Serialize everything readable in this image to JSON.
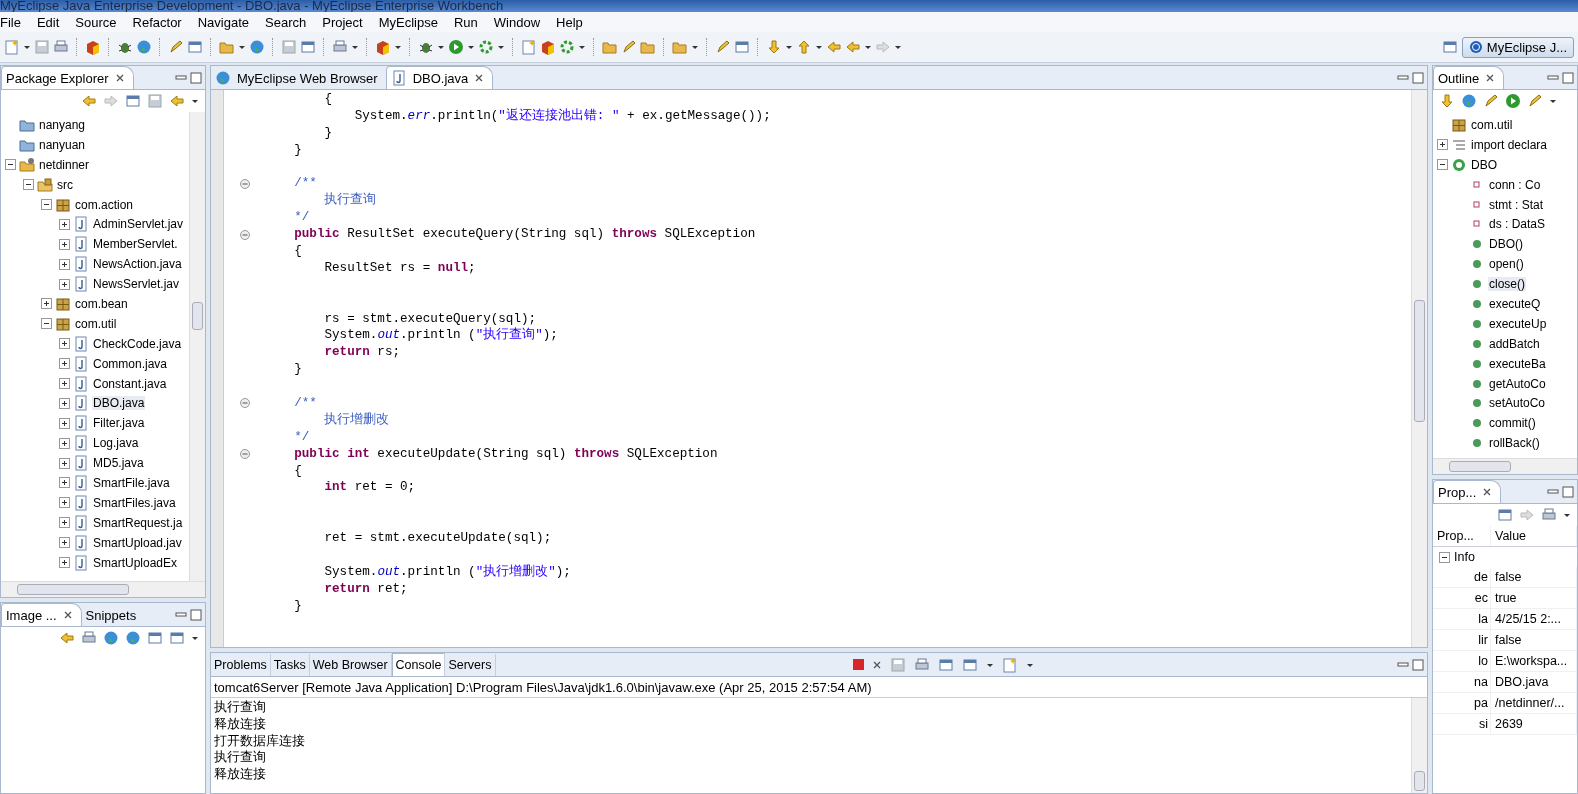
{
  "window": {
    "title": "MyEclipse Java Enterprise Development - DBO.java - MyEclipse Enterprise Workbench"
  },
  "menu": [
    "File",
    "Edit",
    "Source",
    "Refactor",
    "Navigate",
    "Search",
    "Project",
    "MyEclipse",
    "Run",
    "Window",
    "Help"
  ],
  "perspective": {
    "label": "MyEclipse J..."
  },
  "explorer": {
    "tabs": [
      {
        "label": "Package Explorer",
        "selected": true
      }
    ],
    "tree": [
      {
        "kind": "folder",
        "label": "nanyang",
        "selected": false
      },
      {
        "kind": "folder",
        "label": "nanyuan",
        "selected": false
      },
      {
        "kind": "project",
        "label": "netdinner",
        "expanded": true,
        "selected": false,
        "children": [
          {
            "kind": "srcfolder",
            "label": "src",
            "expanded": true,
            "selected": false,
            "children": [
              {
                "kind": "package",
                "label": "com.action",
                "expanded": true,
                "selected": false,
                "children": [
                  {
                    "kind": "javafile",
                    "label": "AdminServlet.jav",
                    "expanded": false,
                    "selected": false
                  },
                  {
                    "kind": "javafile",
                    "label": "MemberServlet.",
                    "expanded": false,
                    "selected": false
                  },
                  {
                    "kind": "javafile",
                    "label": "NewsAction.java",
                    "expanded": false,
                    "selected": false
                  },
                  {
                    "kind": "javafile",
                    "label": "NewsServlet.jav",
                    "expanded": false,
                    "selected": false
                  }
                ]
              },
              {
                "kind": "package",
                "label": "com.bean",
                "expanded": false,
                "selected": false
              },
              {
                "kind": "package",
                "label": "com.util",
                "expanded": true,
                "selected": false,
                "children": [
                  {
                    "kind": "javafile",
                    "label": "CheckCode.java",
                    "expanded": false,
                    "selected": false
                  },
                  {
                    "kind": "javafile",
                    "label": "Common.java",
                    "expanded": false,
                    "selected": false
                  },
                  {
                    "kind": "javafile",
                    "label": "Constant.java",
                    "expanded": false,
                    "selected": false
                  },
                  {
                    "kind": "javafile",
                    "label": "DBO.java",
                    "expanded": false,
                    "selected": true
                  },
                  {
                    "kind": "javafile",
                    "label": "Filter.java",
                    "expanded": false,
                    "selected": false
                  },
                  {
                    "kind": "javafile",
                    "label": "Log.java",
                    "expanded": false,
                    "selected": false
                  },
                  {
                    "kind": "javafile",
                    "label": "MD5.java",
                    "expanded": false,
                    "selected": false
                  },
                  {
                    "kind": "javafile",
                    "label": "SmartFile.java",
                    "expanded": false,
                    "selected": false
                  },
                  {
                    "kind": "javafile",
                    "label": "SmartFiles.java",
                    "expanded": false,
                    "selected": false
                  },
                  {
                    "kind": "javafile",
                    "label": "SmartRequest.ja",
                    "expanded": false,
                    "selected": false
                  },
                  {
                    "kind": "javafile",
                    "label": "SmartUpload.jav",
                    "expanded": false,
                    "selected": false
                  },
                  {
                    "kind": "javafile",
                    "label": "SmartUploadEx",
                    "expanded": false,
                    "selected": false
                  }
                ]
              }
            ]
          }
        ]
      }
    ]
  },
  "image_view": {
    "tabs": [
      {
        "label": "Image ...",
        "selected": true
      },
      {
        "label": "Snippets",
        "selected": false
      }
    ]
  },
  "editor": {
    "tabs": [
      {
        "label": "MyEclipse Web Browser",
        "kind": "browser",
        "selected": false
      },
      {
        "label": "DBO.java",
        "kind": "java",
        "selected": true
      }
    ],
    "lines": [
      {
        "kind": "code",
        "tokens": [
          {
            "kind": "plain",
            "text": "        {"
          }
        ]
      },
      {
        "kind": "code",
        "tokens": [
          {
            "kind": "plain",
            "text": "            System."
          },
          {
            "kind": "field",
            "text": "err"
          },
          {
            "kind": "plain",
            "text": ".println("
          },
          {
            "kind": "string",
            "text": "\"返还连接池出错: \""
          },
          {
            "kind": "plain",
            "text": " + ex.getMessage());"
          }
        ]
      },
      {
        "kind": "code",
        "tokens": [
          {
            "kind": "plain",
            "text": "        }"
          }
        ]
      },
      {
        "kind": "code",
        "tokens": [
          {
            "kind": "plain",
            "text": "    }"
          }
        ]
      },
      {
        "kind": "blank"
      },
      {
        "kind": "code",
        "fold": true,
        "tokens": [
          {
            "kind": "comment",
            "text": "    /**"
          }
        ]
      },
      {
        "kind": "code",
        "tokens": [
          {
            "kind": "comment",
            "text": "        执行查询"
          }
        ]
      },
      {
        "kind": "code",
        "tokens": [
          {
            "kind": "comment",
            "text": "    */"
          }
        ]
      },
      {
        "kind": "code",
        "fold": true,
        "tokens": [
          {
            "kind": "keyword",
            "text": "    public"
          },
          {
            "kind": "plain",
            "text": " ResultSet executeQuery(String sql) "
          },
          {
            "kind": "keyword",
            "text": "throws"
          },
          {
            "kind": "plain",
            "text": " SQLException"
          }
        ]
      },
      {
        "kind": "code",
        "tokens": [
          {
            "kind": "plain",
            "text": "    {"
          }
        ]
      },
      {
        "kind": "code",
        "tokens": [
          {
            "kind": "plain",
            "text": "        ResultSet rs = "
          },
          {
            "kind": "keyword",
            "text": "null"
          },
          {
            "kind": "plain",
            "text": ";"
          }
        ]
      },
      {
        "kind": "blank"
      },
      {
        "kind": "blank"
      },
      {
        "kind": "code",
        "tokens": [
          {
            "kind": "plain",
            "text": "        rs = stmt.executeQuery(sql);"
          }
        ]
      },
      {
        "kind": "code",
        "tokens": [
          {
            "kind": "plain",
            "text": "        System."
          },
          {
            "kind": "field",
            "text": "out"
          },
          {
            "kind": "plain",
            "text": ".println ("
          },
          {
            "kind": "string",
            "text": "\"执行查询\""
          },
          {
            "kind": "plain",
            "text": ");"
          }
        ]
      },
      {
        "kind": "code",
        "tokens": [
          {
            "kind": "keyword",
            "text": "        return"
          },
          {
            "kind": "plain",
            "text": " rs;"
          }
        ]
      },
      {
        "kind": "code",
        "tokens": [
          {
            "kind": "plain",
            "text": "    }"
          }
        ]
      },
      {
        "kind": "blank"
      },
      {
        "kind": "code",
        "fold": true,
        "tokens": [
          {
            "kind": "comment",
            "text": "    /**"
          }
        ]
      },
      {
        "kind": "code",
        "tokens": [
          {
            "kind": "comment",
            "text": "        执行增删改"
          }
        ]
      },
      {
        "kind": "code",
        "tokens": [
          {
            "kind": "comment",
            "text": "    */"
          }
        ]
      },
      {
        "kind": "code",
        "fold": true,
        "tokens": [
          {
            "kind": "keyword",
            "text": "    public int"
          },
          {
            "kind": "plain",
            "text": " executeUpdate(String sql) "
          },
          {
            "kind": "keyword",
            "text": "throws"
          },
          {
            "kind": "plain",
            "text": " SQLException"
          }
        ]
      },
      {
        "kind": "code",
        "tokens": [
          {
            "kind": "plain",
            "text": "    {"
          }
        ]
      },
      {
        "kind": "code",
        "tokens": [
          {
            "kind": "keyword",
            "text": "        int"
          },
          {
            "kind": "plain",
            "text": " ret = 0;"
          }
        ]
      },
      {
        "kind": "blank"
      },
      {
        "kind": "blank"
      },
      {
        "kind": "code",
        "tokens": [
          {
            "kind": "plain",
            "text": "        ret = stmt.executeUpdate(sql);"
          }
        ]
      },
      {
        "kind": "blank"
      },
      {
        "kind": "code",
        "tokens": [
          {
            "kind": "plain",
            "text": "        System."
          },
          {
            "kind": "field",
            "text": "out"
          },
          {
            "kind": "plain",
            "text": ".println ("
          },
          {
            "kind": "string",
            "text": "\"执行增删改\""
          },
          {
            "kind": "plain",
            "text": ");"
          }
        ]
      },
      {
        "kind": "code",
        "tokens": [
          {
            "kind": "keyword",
            "text": "        return"
          },
          {
            "kind": "plain",
            "text": " ret;"
          }
        ]
      },
      {
        "kind": "code",
        "tokens": [
          {
            "kind": "plain",
            "text": "    }"
          }
        ]
      }
    ]
  },
  "console": {
    "tabs": [
      {
        "label": "Problems",
        "selected": false
      },
      {
        "label": "Tasks",
        "selected": false
      },
      {
        "label": "Web Browser",
        "selected": false
      },
      {
        "label": "Console",
        "selected": true
      },
      {
        "label": "Servers",
        "selected": false
      }
    ],
    "process": "tomcat6Server [Remote Java Application] D:\\Program Files\\Java\\jdk1.6.0\\bin\\javaw.exe (Apr 25, 2015 2:57:54 AM)",
    "output": [
      "执行查询",
      "释放连接",
      "打开数据库连接",
      "执行查询",
      "释放连接"
    ]
  },
  "outline": {
    "tabs": [
      {
        "label": "Outline",
        "selected": true
      }
    ],
    "items": [
      {
        "kind": "package",
        "label": "com.util",
        "selected": false
      },
      {
        "kind": "import",
        "label": "import declara",
        "expanded": false,
        "selected": false
      },
      {
        "kind": "class",
        "label": "DBO",
        "expanded": true,
        "selected": false,
        "children": [
          {
            "kind": "field",
            "label": "conn : Co",
            "selected": false
          },
          {
            "kind": "field",
            "label": "stmt : Stat",
            "selected": false
          },
          {
            "kind": "field",
            "label": "ds : DataS",
            "selected": false
          },
          {
            "kind": "constructor",
            "label": "DBO()",
            "selected": false
          },
          {
            "kind": "method",
            "label": "open()",
            "selected": false
          },
          {
            "kind": "method",
            "label": "close()",
            "selected": true
          },
          {
            "kind": "method",
            "label": "executeQ",
            "selected": false
          },
          {
            "kind": "method",
            "label": "executeUp",
            "selected": false
          },
          {
            "kind": "method",
            "label": "addBatch",
            "selected": false
          },
          {
            "kind": "method",
            "label": "executeBa",
            "selected": false
          },
          {
            "kind": "method",
            "label": "getAutoCo",
            "selected": false
          },
          {
            "kind": "method",
            "label": "setAutoCo",
            "selected": false
          },
          {
            "kind": "method",
            "label": "commit()",
            "selected": false
          },
          {
            "kind": "method",
            "label": "rollBack()",
            "selected": false
          }
        ]
      }
    ]
  },
  "properties": {
    "tabs": [
      {
        "label": "Prop...",
        "selected": true
      }
    ],
    "columns": [
      "Prop...",
      "Value"
    ],
    "group": {
      "label": "Info",
      "expanded": true
    },
    "rows": [
      {
        "name": "de",
        "value": "false"
      },
      {
        "name": "ec",
        "value": "true"
      },
      {
        "name": "la",
        "value": "4/25/15 2:..."
      },
      {
        "name": "lir",
        "value": "false"
      },
      {
        "name": "lo",
        "value": "E:\\workspa..."
      },
      {
        "name": "na",
        "value": "DBO.java"
      },
      {
        "name": "pa",
        "value": "/netdinner/..."
      },
      {
        "name": "si",
        "value": "2639"
      }
    ]
  }
}
